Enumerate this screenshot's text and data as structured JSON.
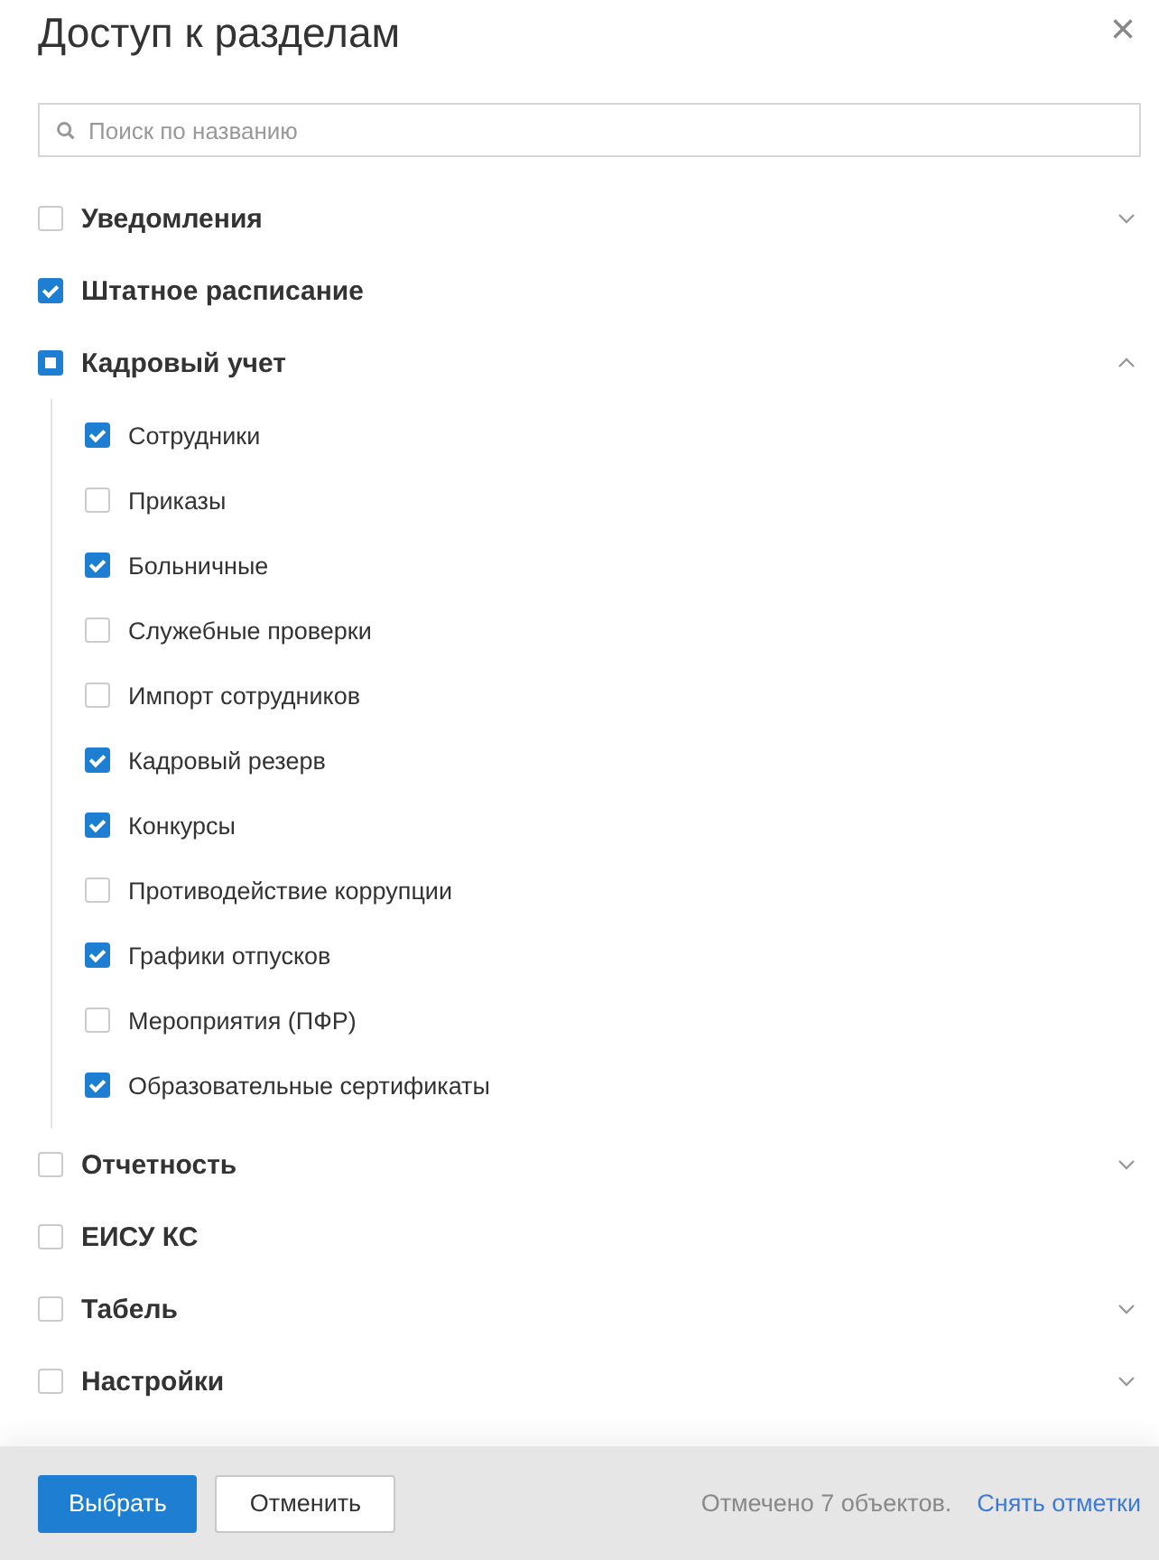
{
  "dialog": {
    "title": "Доступ к разделам",
    "close_icon": "×"
  },
  "search": {
    "placeholder": "Поиск по названию"
  },
  "sections": [
    {
      "label": "Уведомления",
      "checked": false,
      "partial": false,
      "kind": "group",
      "expanded": false
    },
    {
      "label": "Штатное расписание",
      "checked": true,
      "partial": false,
      "kind": "leaf"
    },
    {
      "label": "Кадровый учет",
      "checked": false,
      "partial": true,
      "kind": "group",
      "expanded": true,
      "children": [
        {
          "label": "Сотрудники",
          "checked": true
        },
        {
          "label": "Приказы",
          "checked": false
        },
        {
          "label": "Больничные",
          "checked": true
        },
        {
          "label": "Служебные проверки",
          "checked": false
        },
        {
          "label": "Импорт сотрудников",
          "checked": false
        },
        {
          "label": "Кадровый резерв",
          "checked": true
        },
        {
          "label": "Конкурсы",
          "checked": true
        },
        {
          "label": "Противодействие коррупции",
          "checked": false
        },
        {
          "label": "Графики отпусков",
          "checked": true
        },
        {
          "label": "Мероприятия (ПФР)",
          "checked": false
        },
        {
          "label": "Образовательные сертификаты",
          "checked": true
        }
      ]
    },
    {
      "label": "Отчетность",
      "checked": false,
      "partial": false,
      "kind": "group",
      "expanded": false
    },
    {
      "label": "ЕИСУ КС",
      "checked": false,
      "partial": false,
      "kind": "leaf"
    },
    {
      "label": "Табель",
      "checked": false,
      "partial": false,
      "kind": "group",
      "expanded": false
    },
    {
      "label": "Настройки",
      "checked": false,
      "partial": false,
      "kind": "group",
      "expanded": false
    }
  ],
  "footer": {
    "buttons": [
      {
        "label": "Выбрать",
        "kind": "primary"
      },
      {
        "label": "Отменить",
        "kind": "secondary"
      }
    ],
    "summary": "Отмечено 7 объектов.",
    "clear_link": "Снять отметки"
  }
}
